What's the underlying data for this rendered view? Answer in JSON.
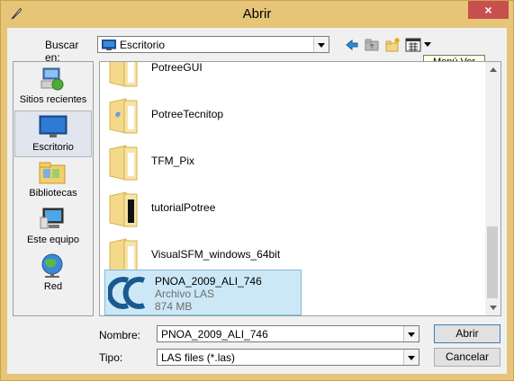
{
  "window": {
    "title": "Abrir",
    "close_glyph": "×"
  },
  "toolbar": {
    "lookin_label": "Buscar en:",
    "lookin_value": "Escritorio",
    "back_icon": "back-arrow-icon",
    "up_icon": "up-folder-icon",
    "newfolder_icon": "new-folder-icon",
    "view_icon": "view-menu-icon",
    "tooltip": "Menú Ver"
  },
  "places": [
    {
      "label": "Sitios recientes",
      "icon": "recent-places-icon"
    },
    {
      "label": "Escritorio",
      "icon": "desktop-icon"
    },
    {
      "label": "Bibliotecas",
      "icon": "libraries-icon"
    },
    {
      "label": "Este equipo",
      "icon": "computer-icon"
    },
    {
      "label": "Red",
      "icon": "network-icon"
    }
  ],
  "files": [
    {
      "name": "PotreeGUI",
      "type": "folder"
    },
    {
      "name": "PotreeTecnitop",
      "type": "folder"
    },
    {
      "name": "TFM_Pix",
      "type": "folder"
    },
    {
      "name": "tutorialPotree",
      "type": "folder"
    },
    {
      "name": "VisualSFM_windows_64bit",
      "type": "folder"
    }
  ],
  "selected_file": {
    "name": "PNOA_2009_ALI_746",
    "kind": "Archivo LAS",
    "size": "874 MB"
  },
  "bottom": {
    "name_label": "Nombre:",
    "name_value": "PNOA_2009_ALI_746",
    "type_label": "Tipo:",
    "type_value": "LAS files (*.las)",
    "open_button": "Abrir",
    "cancel_button": "Cancelar"
  },
  "colors": {
    "titlebar": "#e6c579",
    "close": "#c7504f",
    "selection": "#cce8f6"
  }
}
